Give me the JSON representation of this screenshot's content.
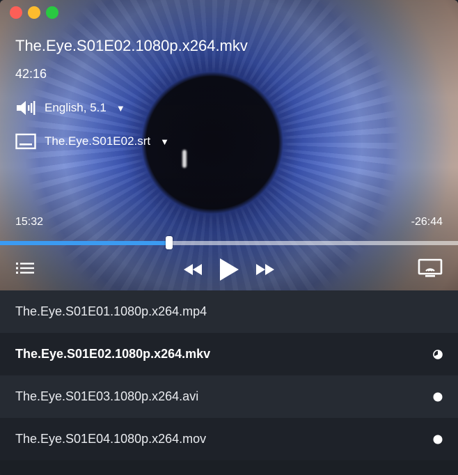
{
  "window": {
    "controls": [
      "close",
      "minimize",
      "maximize"
    ]
  },
  "player": {
    "title": "The.Eye.S01E02.1080p.x264.mkv",
    "duration": "42:16",
    "audio_track": "English, 5.1",
    "subtitle_track": "The.Eye.S01E02.srt",
    "elapsed": "15:32",
    "remaining": "-26:44",
    "progress_percent": 37,
    "accent_color": "#3b9bf2",
    "icons": {
      "audio": "speaker-icon",
      "subtitles": "subtitles-icon",
      "playlist": "list-icon",
      "rewind": "rewind-icon",
      "play": "play-icon",
      "fast_forward": "fast-forward-icon",
      "cast": "airplay-icon"
    }
  },
  "playlist": {
    "items": [
      {
        "label": "The.Eye.S01E01.1080p.x264.mp4",
        "status": "none",
        "active": false
      },
      {
        "label": "The.Eye.S01E02.1080p.x264.mkv",
        "status": "partial",
        "active": true
      },
      {
        "label": "The.Eye.S01E03.1080p.x264.avi",
        "status": "unwatched",
        "active": false
      },
      {
        "label": "The.Eye.S01E04.1080p.x264.mov",
        "status": "unwatched",
        "active": false
      }
    ]
  }
}
